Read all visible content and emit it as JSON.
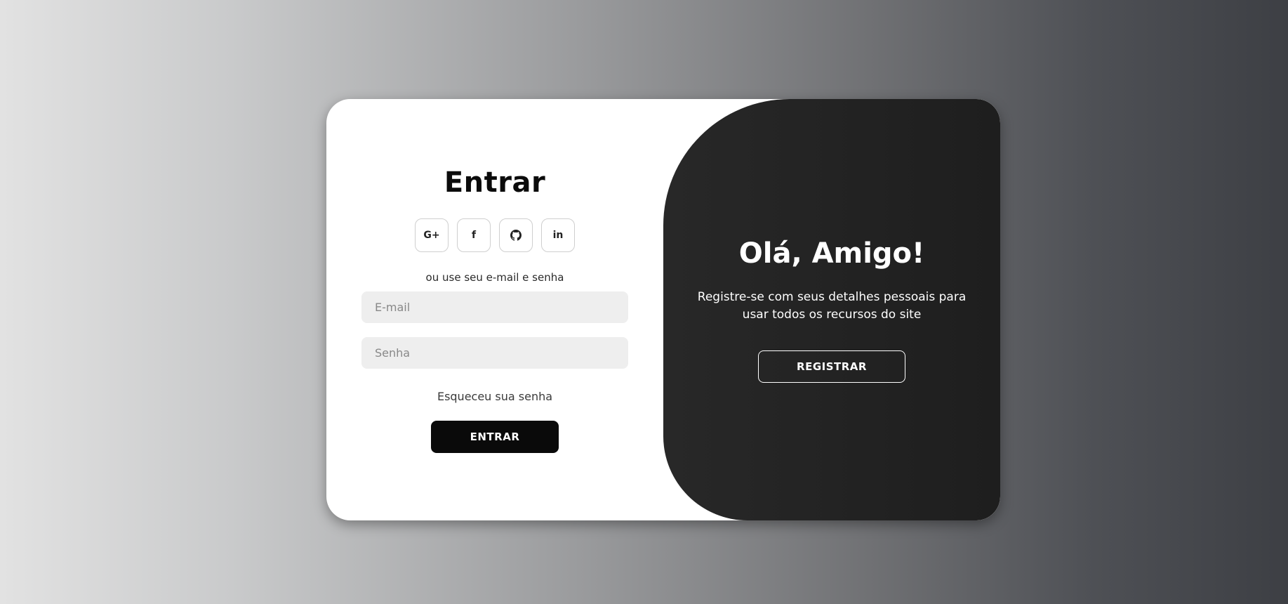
{
  "signin": {
    "title": "Entrar",
    "socials": [
      {
        "icon": "google-plus-icon",
        "glyph": "G+"
      },
      {
        "icon": "facebook-icon",
        "glyph": "f"
      },
      {
        "icon": "github-icon",
        "glyph": ""
      },
      {
        "icon": "linkedin-icon",
        "glyph": "in"
      }
    ],
    "alt_text": "ou use seu e-mail e senha",
    "email_placeholder": "E-mail",
    "password_placeholder": "Senha",
    "forgot": "Esqueceu sua senha",
    "submit_label": "ENTRAR"
  },
  "panel": {
    "title": "Olá, Amigo!",
    "text": "Registre-se com seus detalhes pessoais para usar todos os recursos do site",
    "register_label": "REGISTRAR"
  },
  "colors": {
    "primary": "#0a0a0a",
    "panel": "#222222",
    "input_bg": "#eeeeee"
  }
}
